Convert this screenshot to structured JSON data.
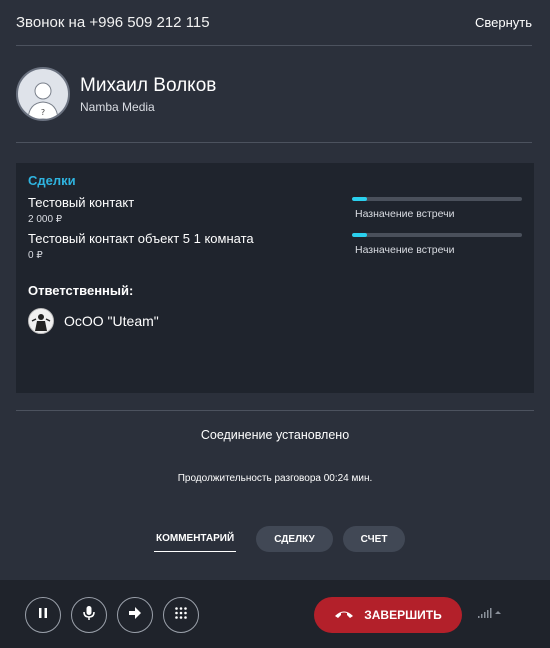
{
  "header": {
    "title": "Звонок на +996 509 212 115",
    "collapse_label": "Свернуть"
  },
  "contact": {
    "name": "Михаил Волков",
    "company": "Namba Media",
    "avatar_icon": "user-placeholder-icon"
  },
  "deals": {
    "title": "Сделки",
    "items": [
      {
        "name": "Тестовый контакт",
        "sum": "2 000 ₽",
        "stage": "Назначение встречи",
        "progress": 0.09
      },
      {
        "name": "Тестовый контакт объект 5 1 комната",
        "sum": "0 ₽",
        "stage": "Назначение встречи",
        "progress": 0.09
      }
    ],
    "responsible_label": "Ответственный:",
    "responsible_name": "ОсОО \"Uteam\""
  },
  "call": {
    "status": "Соединение установлено",
    "duration": "Продолжительность разговора 00:24 мин."
  },
  "tabs": [
    {
      "label": "КОММЕНТАРИЙ",
      "active": true
    },
    {
      "label": "СДЕЛКУ",
      "active": false
    },
    {
      "label": "СЧЕТ",
      "active": false
    }
  ],
  "controls": {
    "icons": [
      "pause-icon",
      "microphone-icon",
      "transfer-arrow-icon",
      "keypad-icon"
    ],
    "end_call_label": "ЗАВЕРШИТЬ"
  },
  "colors": {
    "accent": "#2fb4e0",
    "progress": "#2ad0ee",
    "end_call": "#b3202a",
    "background": "#2b303b",
    "panel": "#1f242d"
  }
}
